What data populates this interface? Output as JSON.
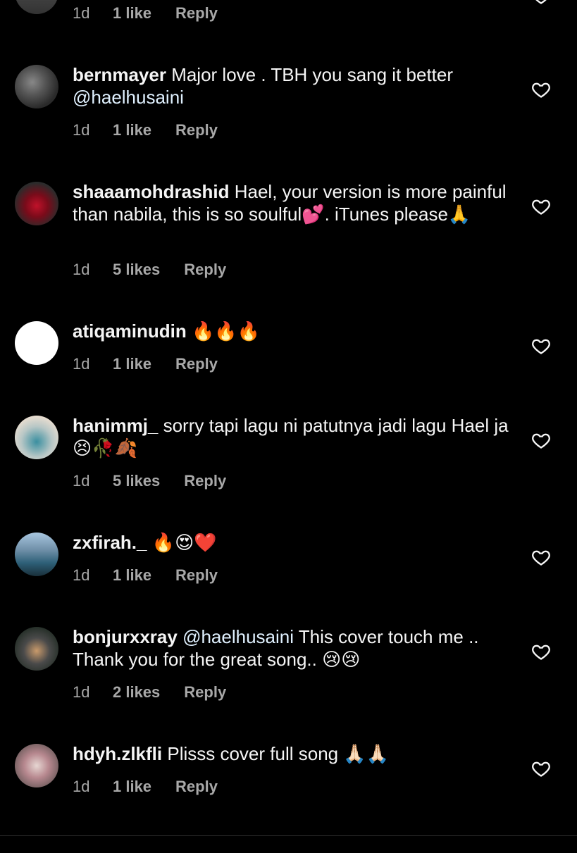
{
  "top_row": {
    "time": "1d",
    "likes": "1 like",
    "reply": "Reply"
  },
  "comments": [
    {
      "username": "bernmayer",
      "text_before": " Major love . TBH you sang it better ",
      "mention": "@haelhusaini",
      "text_after": "",
      "time": "1d",
      "likes": "1 like",
      "reply": "Reply",
      "avatar": "dark-room-photo"
    },
    {
      "username": "shaaamohdrashid",
      "text_before": " Hael, your version is more painful than nabila, this is so soulful💕. iTunes please🙏",
      "mention": "",
      "text_after": "",
      "time": "1d",
      "likes": "5 likes",
      "reply": "Reply",
      "avatar": "red-bouquet-photo"
    },
    {
      "username": "atiqaminudin",
      "text_before": " 🔥🔥🔥",
      "mention": "",
      "text_after": "",
      "time": "1d",
      "likes": "1 like",
      "reply": "Reply",
      "avatar": "blank-white"
    },
    {
      "username": "hanimmj_",
      "text_before": " sorry tapi lagu ni patutnya jadi lagu Hael ja 😣🥀🍂",
      "mention": "",
      "text_after": "",
      "time": "1d",
      "likes": "5 likes",
      "reply": "Reply",
      "avatar": "person-in-hijab-photo"
    },
    {
      "username": "zxfirah._",
      "text_before": " 🔥😍❤️",
      "mention": "",
      "text_after": "",
      "time": "1d",
      "likes": "1 like",
      "reply": "Reply",
      "avatar": "outdoor-selfie-photo"
    },
    {
      "username": "bonjurxxray",
      "text_before": " ",
      "mention": "@haelhusaini",
      "text_after": " This cover touch me .. Thank you for the great song.. 😢😢",
      "time": "1d",
      "likes": "2 likes",
      "reply": "Reply",
      "avatar": "person-portrait-photo"
    },
    {
      "username": "hdyh.zlkfli",
      "text_before": " Plisss cover full song 🙏🏻🙏🏻",
      "mention": "",
      "text_after": "",
      "time": "1d",
      "likes": "1 like",
      "reply": "Reply",
      "avatar": "pink-photo"
    }
  ],
  "colors": {
    "background": "#000000",
    "text": "#f5f5f5",
    "meta": "#a8a8a8",
    "mention": "#e0f1ff"
  },
  "icons": {
    "like": "heart-outline-icon"
  }
}
